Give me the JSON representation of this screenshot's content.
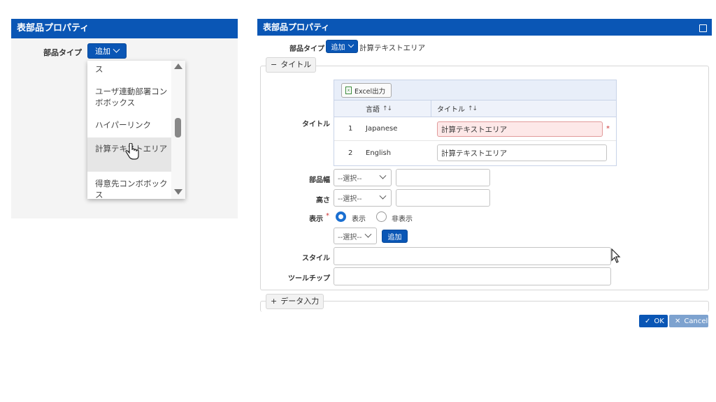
{
  "left": {
    "title": "表部品プロパティ",
    "type_label": "部品タイプ",
    "type_button": "追加",
    "dropdown_items": [
      "ス",
      "ユーザ連動部署コンボボックス",
      "ハイパーリンク",
      "計算テキストエリア",
      "得意先コンボボックス"
    ]
  },
  "dialog": {
    "title": "表部品プロパティ",
    "type_label": "部品タイプ",
    "type_button": "追加",
    "type_value": "計算テキストエリア",
    "section_title": "タイトル",
    "title_label": "タイトル",
    "grid": {
      "excel_button": "Excel出力",
      "headers": [
        "言語",
        "タイトル"
      ],
      "sort_icon": "↑↓",
      "rows": [
        {
          "num": "1",
          "lang": "Japanese",
          "title": "計算テキストエリア",
          "required": "*"
        },
        {
          "num": "2",
          "lang": "English",
          "title": "計算テキストエリア"
        }
      ]
    },
    "width_label": "部品幅",
    "height_label": "高さ",
    "select_placeholder": "--選択--",
    "display_label": "表示",
    "required_mark": "*",
    "display_options": [
      "表示",
      "非表示"
    ],
    "add_button": "追加",
    "style_label": "スタイル",
    "tooltip_label": "ツールチップ",
    "data_section": "データ入力",
    "ok_button": "OK",
    "cancel_button": "Cancel"
  },
  "colors": {
    "header": "#0a56b5",
    "ok": "#0a56b5",
    "cancel": "#7da2cf",
    "error_bg": "#fde8e8"
  }
}
